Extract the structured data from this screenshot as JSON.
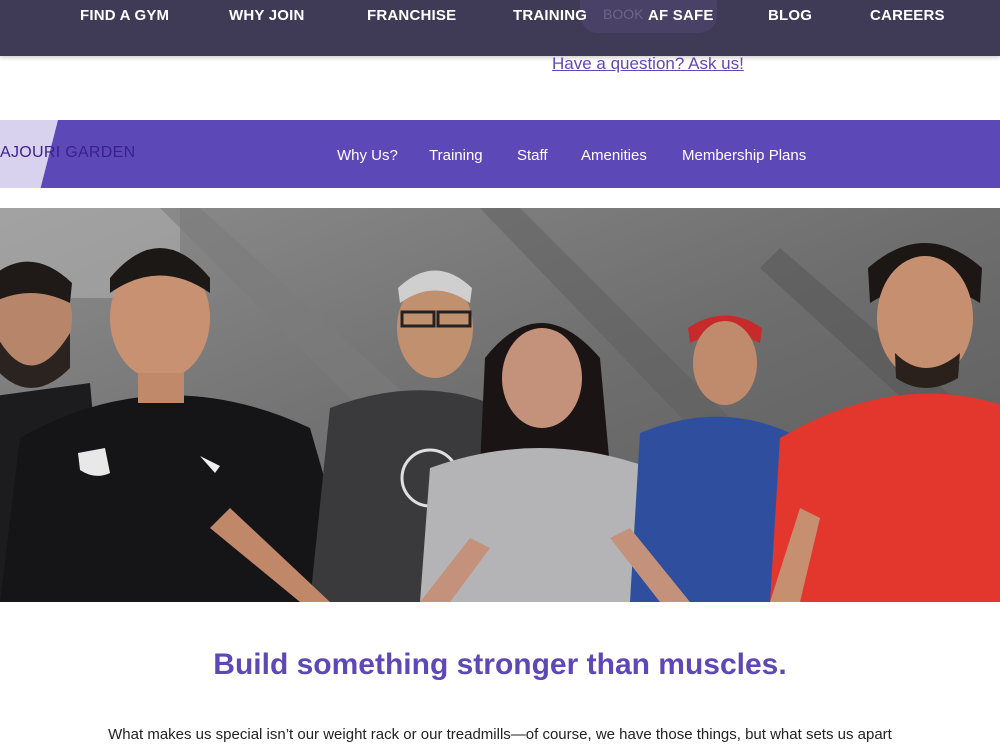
{
  "top_nav": {
    "items": [
      "FIND A GYM",
      "WHY JOIN",
      "FRANCHISE",
      "TRAINING",
      "AF SAFE",
      "BLOG",
      "CAREERS"
    ],
    "book_label": "BOOK"
  },
  "question_link": "Have a question? Ask us!",
  "club_bar": {
    "club_name": "AJOURI GARDEN",
    "links": [
      "Why Us?",
      "Training",
      "Staff",
      "Amenities",
      "Membership Plans"
    ]
  },
  "hero": {
    "description_icon": "group-meditation-photo"
  },
  "content": {
    "headline": "Build something stronger than muscles.",
    "body": "What makes us special isn’t our weight rack or our treadmills—of course, we have those things, but what sets us apart"
  },
  "colors": {
    "nav_bg": "#3f3a55",
    "brand_purple": "#5d48b8",
    "link_purple": "#6446b9"
  }
}
